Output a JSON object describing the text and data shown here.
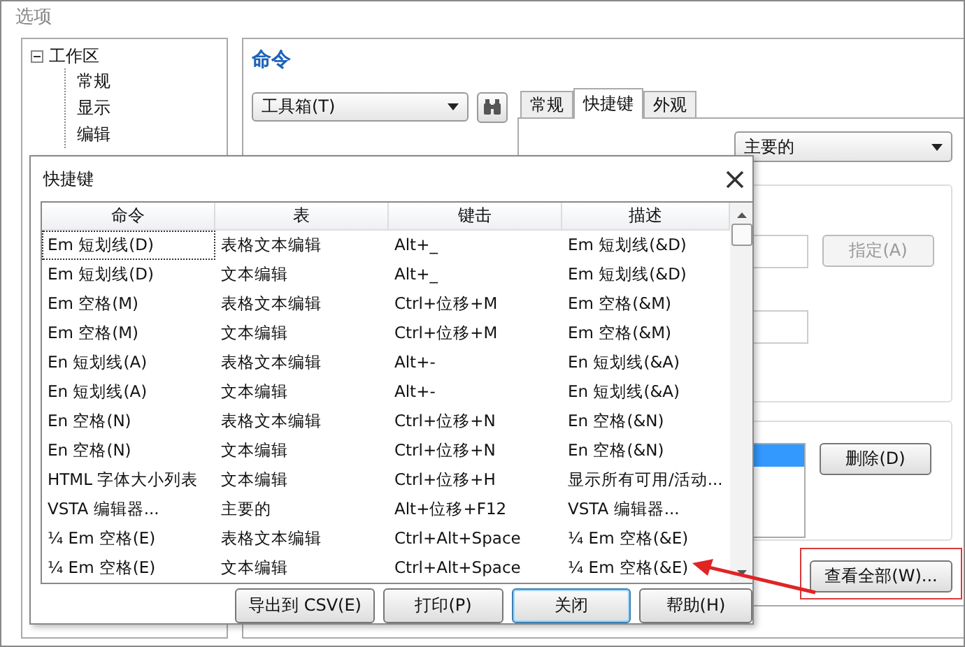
{
  "window": {
    "title": "选项"
  },
  "tree": {
    "items": [
      {
        "label": "工作区",
        "expanded": true,
        "children": [
          {
            "label": "常规"
          },
          {
            "label": "显示"
          },
          {
            "label": "编辑"
          }
        ]
      }
    ]
  },
  "section_title": "命令",
  "category_dropdown": {
    "value": "工具箱(T)"
  },
  "tabs": [
    {
      "label": "常规",
      "selected": false
    },
    {
      "label": "快捷键",
      "selected": true
    },
    {
      "label": "外观",
      "selected": false
    }
  ],
  "shortcut_table_dropdown": {
    "value": "主要的"
  },
  "assign_button": {
    "label": "指定(A)",
    "disabled": true
  },
  "delete_button": {
    "label": "删除(D)",
    "disabled": false
  },
  "view_all_button": {
    "label": "查看全部(W)...",
    "highlighted": true
  },
  "dialog": {
    "title": "快捷键",
    "columns": [
      "命令",
      "表",
      "键击",
      "描述"
    ],
    "rows": [
      {
        "cells": [
          "Em 短划线(D)",
          "表格文本编辑",
          "Alt+_",
          "Em 短划线(&D)"
        ],
        "focused": true
      },
      {
        "cells": [
          "Em 短划线(D)",
          "文本编辑",
          "Alt+_",
          "Em 短划线(&D)"
        ],
        "focused": false
      },
      {
        "cells": [
          "Em 空格(M)",
          "表格文本编辑",
          "Ctrl+位移+M",
          "Em 空格(&M)"
        ],
        "focused": false
      },
      {
        "cells": [
          "Em 空格(M)",
          "文本编辑",
          "Ctrl+位移+M",
          "Em 空格(&M)"
        ],
        "focused": false
      },
      {
        "cells": [
          "En 短划线(A)",
          "表格文本编辑",
          "Alt+-",
          "En 短划线(&A)"
        ],
        "focused": false
      },
      {
        "cells": [
          "En 短划线(A)",
          "文本编辑",
          "Alt+-",
          "En 短划线(&A)"
        ],
        "focused": false
      },
      {
        "cells": [
          "En 空格(N)",
          "表格文本编辑",
          "Ctrl+位移+N",
          "En 空格(&N)"
        ],
        "focused": false
      },
      {
        "cells": [
          "En 空格(N)",
          "文本编辑",
          "Ctrl+位移+N",
          "En 空格(&N)"
        ],
        "focused": false
      },
      {
        "cells": [
          "HTML 字体大小列表",
          "文本编辑",
          "Ctrl+位移+H",
          "显示所有可用/活动..."
        ],
        "focused": false
      },
      {
        "cells": [
          "VSTA 编辑器...",
          "主要的",
          "Alt+位移+F12",
          "VSTA 编辑器..."
        ],
        "focused": false
      },
      {
        "cells": [
          "¼ Em 空格(E)",
          "表格文本编辑",
          "Ctrl+Alt+Space",
          "¼ Em 空格(&E)"
        ],
        "focused": false
      },
      {
        "cells": [
          "¼ Em 空格(E)",
          "文本编辑",
          "Ctrl+Alt+Space",
          "¼ Em 空格(&E)"
        ],
        "focused": false
      }
    ],
    "buttons": [
      {
        "label": "导出到 CSV(E)",
        "focused": false
      },
      {
        "label": "打印(P)",
        "focused": false
      },
      {
        "label": "关闭",
        "focused": true
      },
      {
        "label": "帮助(H)",
        "focused": false
      }
    ]
  }
}
